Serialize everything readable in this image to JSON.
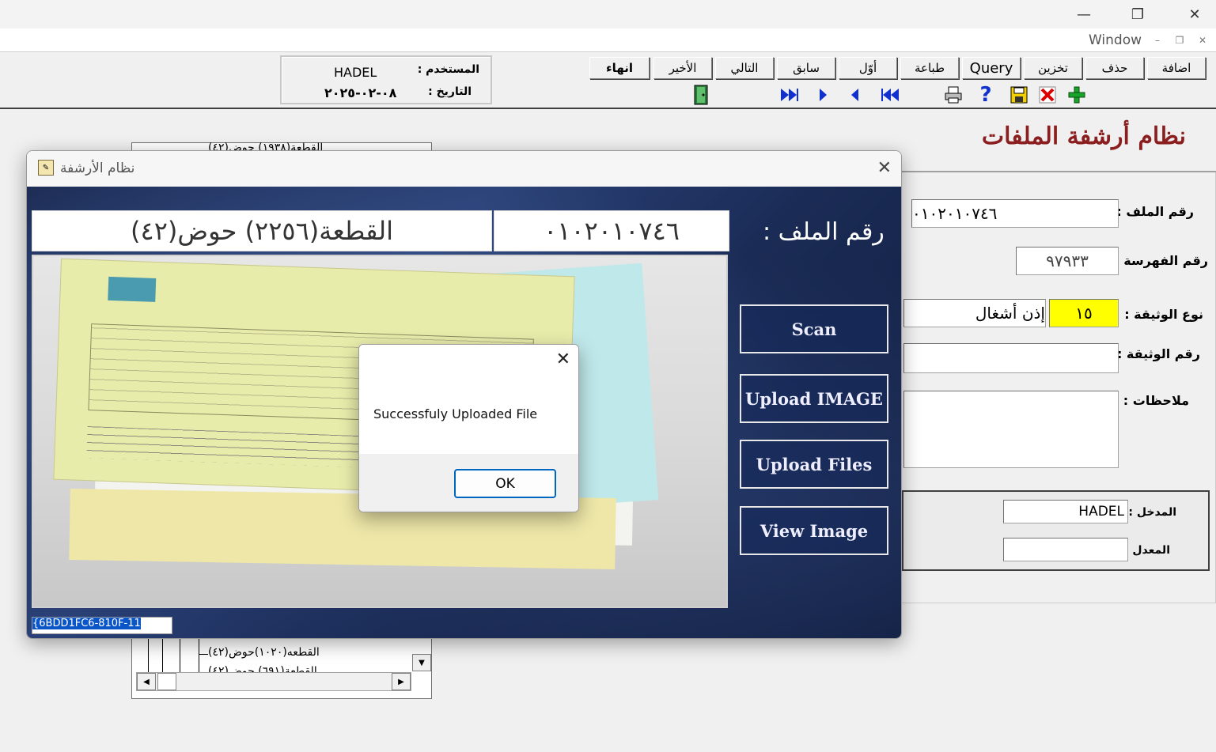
{
  "window": {
    "minimize_glyph": "—",
    "maximize_glyph": "❐",
    "close_glyph": "✕",
    "menu_window": "Window",
    "mdi_min": "–",
    "mdi_restore": "❐",
    "mdi_close": "✕"
  },
  "userbox": {
    "user_label": "المستخدم :",
    "user_value": "HADEL",
    "date_label": "التاريخ :",
    "date_value": "٠٨-٠٢-٢٠٢٥"
  },
  "toolbar": {
    "add": "اضافة",
    "delete": "حذف",
    "store": "تخزين",
    "query": "Query",
    "print": "طباعة",
    "first": "أوّل",
    "previous": "سابق",
    "next": "التالي",
    "last": "الأخير",
    "exit": "انهاء"
  },
  "icons": {
    "exit": "door-exit-icon",
    "last": "last-record-icon",
    "next": "next-record-icon",
    "previous": "previous-record-icon",
    "first": "first-record-icon",
    "print": "printer-icon",
    "help": "help-icon",
    "save": "save-icon",
    "cancel": "cancel-icon",
    "new": "add-record-icon"
  },
  "form": {
    "app_title": "نظام أرشفة الملفات",
    "file_no_label": "رقم الملف :",
    "file_no_value": "٠١٠٢٠١٠٧٤٦",
    "index_no_label": "رقم الفهرسة :",
    "index_no_value": "٩٧٩٣٣",
    "doc_type_label": "نوع الوثيقة :",
    "doc_type_code": "١٥",
    "doc_type_name": "إذن أشغال",
    "doc_no_label": "رقم الوثيقة :",
    "doc_no_value": "",
    "notes_label": "ملاحظات :",
    "notes_value": "",
    "entered_by_label": "المدخل :",
    "entered_by_value": "HADEL",
    "modified_by_label": "المعدل :",
    "modified_by_value": ""
  },
  "tree": {
    "top_item": "القطعة(١٩٣٨) حوض(٤٢)",
    "bottom_item": "القطعه(١٠٢٠)حوض(٤٢)",
    "bottom_item2": "القطعة(٦٩١) حوض(٤٢)"
  },
  "archive": {
    "title": "نظام الأرشفة",
    "file_label": "رقم الملف :",
    "file_value": "٠١٠٢٠١٠٧٤٦",
    "parcel_value": "القطعة(٢٢٥٦) حوض(٤٢)",
    "btn_scan": "Scan",
    "btn_upload_image": "Upload IMAGE",
    "btn_upload_files": "Upload Files",
    "btn_view_image": "View Image",
    "guid": "{6BDD1FC6-810F-11"
  },
  "msgbox": {
    "text": "Successfuly Uploaded File",
    "ok": "OK"
  }
}
